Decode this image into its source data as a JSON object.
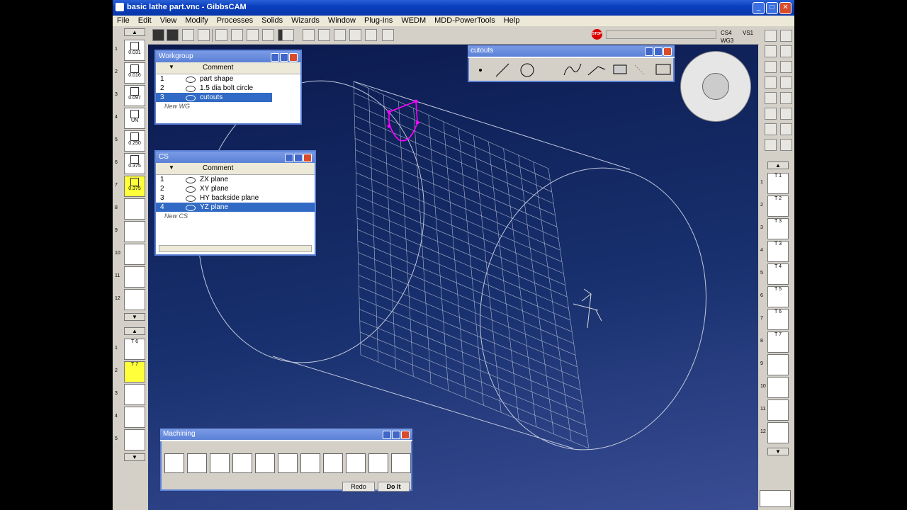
{
  "window": {
    "title": "basic lathe part.vnc - GibbsCAM",
    "minimize": "_",
    "maximize": "□",
    "close": "✕"
  },
  "menu": [
    "File",
    "Edit",
    "View",
    "Modify",
    "Processes",
    "Solids",
    "Wizards",
    "Window",
    "Plug-Ins",
    "WEDM",
    "MDD-PowerTools",
    "Help"
  ],
  "status": {
    "cs": "CS4",
    "vs": "VS1",
    "wg": "WG3"
  },
  "left_tools": [
    {
      "num": "1",
      "label": "0.031"
    },
    {
      "num": "2",
      "label": "0.016"
    },
    {
      "num": "3",
      "label": "0.097"
    },
    {
      "num": "4",
      "label": "UN"
    },
    {
      "num": "5",
      "label": "0.250"
    },
    {
      "num": "6",
      "label": "0.375"
    },
    {
      "num": "7",
      "label": "0.375"
    },
    {
      "num": "8",
      "label": ""
    },
    {
      "num": "9",
      "label": ""
    },
    {
      "num": "10",
      "label": ""
    },
    {
      "num": "11",
      "label": ""
    },
    {
      "num": "12",
      "label": ""
    }
  ],
  "left_tools2": [
    {
      "num": "1",
      "label": "T 6"
    },
    {
      "num": "2",
      "label": "T 7"
    },
    {
      "num": "3",
      "label": ""
    },
    {
      "num": "4",
      "label": ""
    },
    {
      "num": "5",
      "label": ""
    }
  ],
  "right_tools": [
    {
      "num": "1",
      "label": "T 1"
    },
    {
      "num": "2",
      "label": "T 2"
    },
    {
      "num": "3",
      "label": "T 3"
    },
    {
      "num": "4",
      "label": "T 3"
    },
    {
      "num": "5",
      "label": "T 4"
    },
    {
      "num": "6",
      "label": "T 5"
    },
    {
      "num": "7",
      "label": "T 6"
    },
    {
      "num": "8",
      "label": "T 7"
    },
    {
      "num": "9",
      "label": ""
    },
    {
      "num": "10",
      "label": ""
    },
    {
      "num": "11",
      "label": ""
    },
    {
      "num": "12",
      "label": ""
    }
  ],
  "workgroup": {
    "title": "Workgroup",
    "column": "Comment",
    "rows": [
      {
        "num": "1",
        "comment": "part shape"
      },
      {
        "num": "2",
        "comment": "1.5 dia bolt circle"
      },
      {
        "num": "3",
        "comment": "cutouts"
      }
    ],
    "new_label": "New WG"
  },
  "cs": {
    "title": "CS",
    "column": "Comment",
    "rows": [
      {
        "num": "1",
        "comment": "ZX plane"
      },
      {
        "num": "2",
        "comment": "XY plane"
      },
      {
        "num": "3",
        "comment": "HY backside plane"
      },
      {
        "num": "4",
        "comment": "YZ plane"
      }
    ],
    "new_label": "New CS"
  },
  "cutouts": {
    "title": "cutouts"
  },
  "machining": {
    "title": "Machining",
    "redo": "Redo",
    "doit": "Do It"
  },
  "colors": {
    "accent": "#316ac5",
    "titlebar": "#0a3fbf",
    "highlight": "#ffff3a",
    "curve": "#ff00ff"
  }
}
